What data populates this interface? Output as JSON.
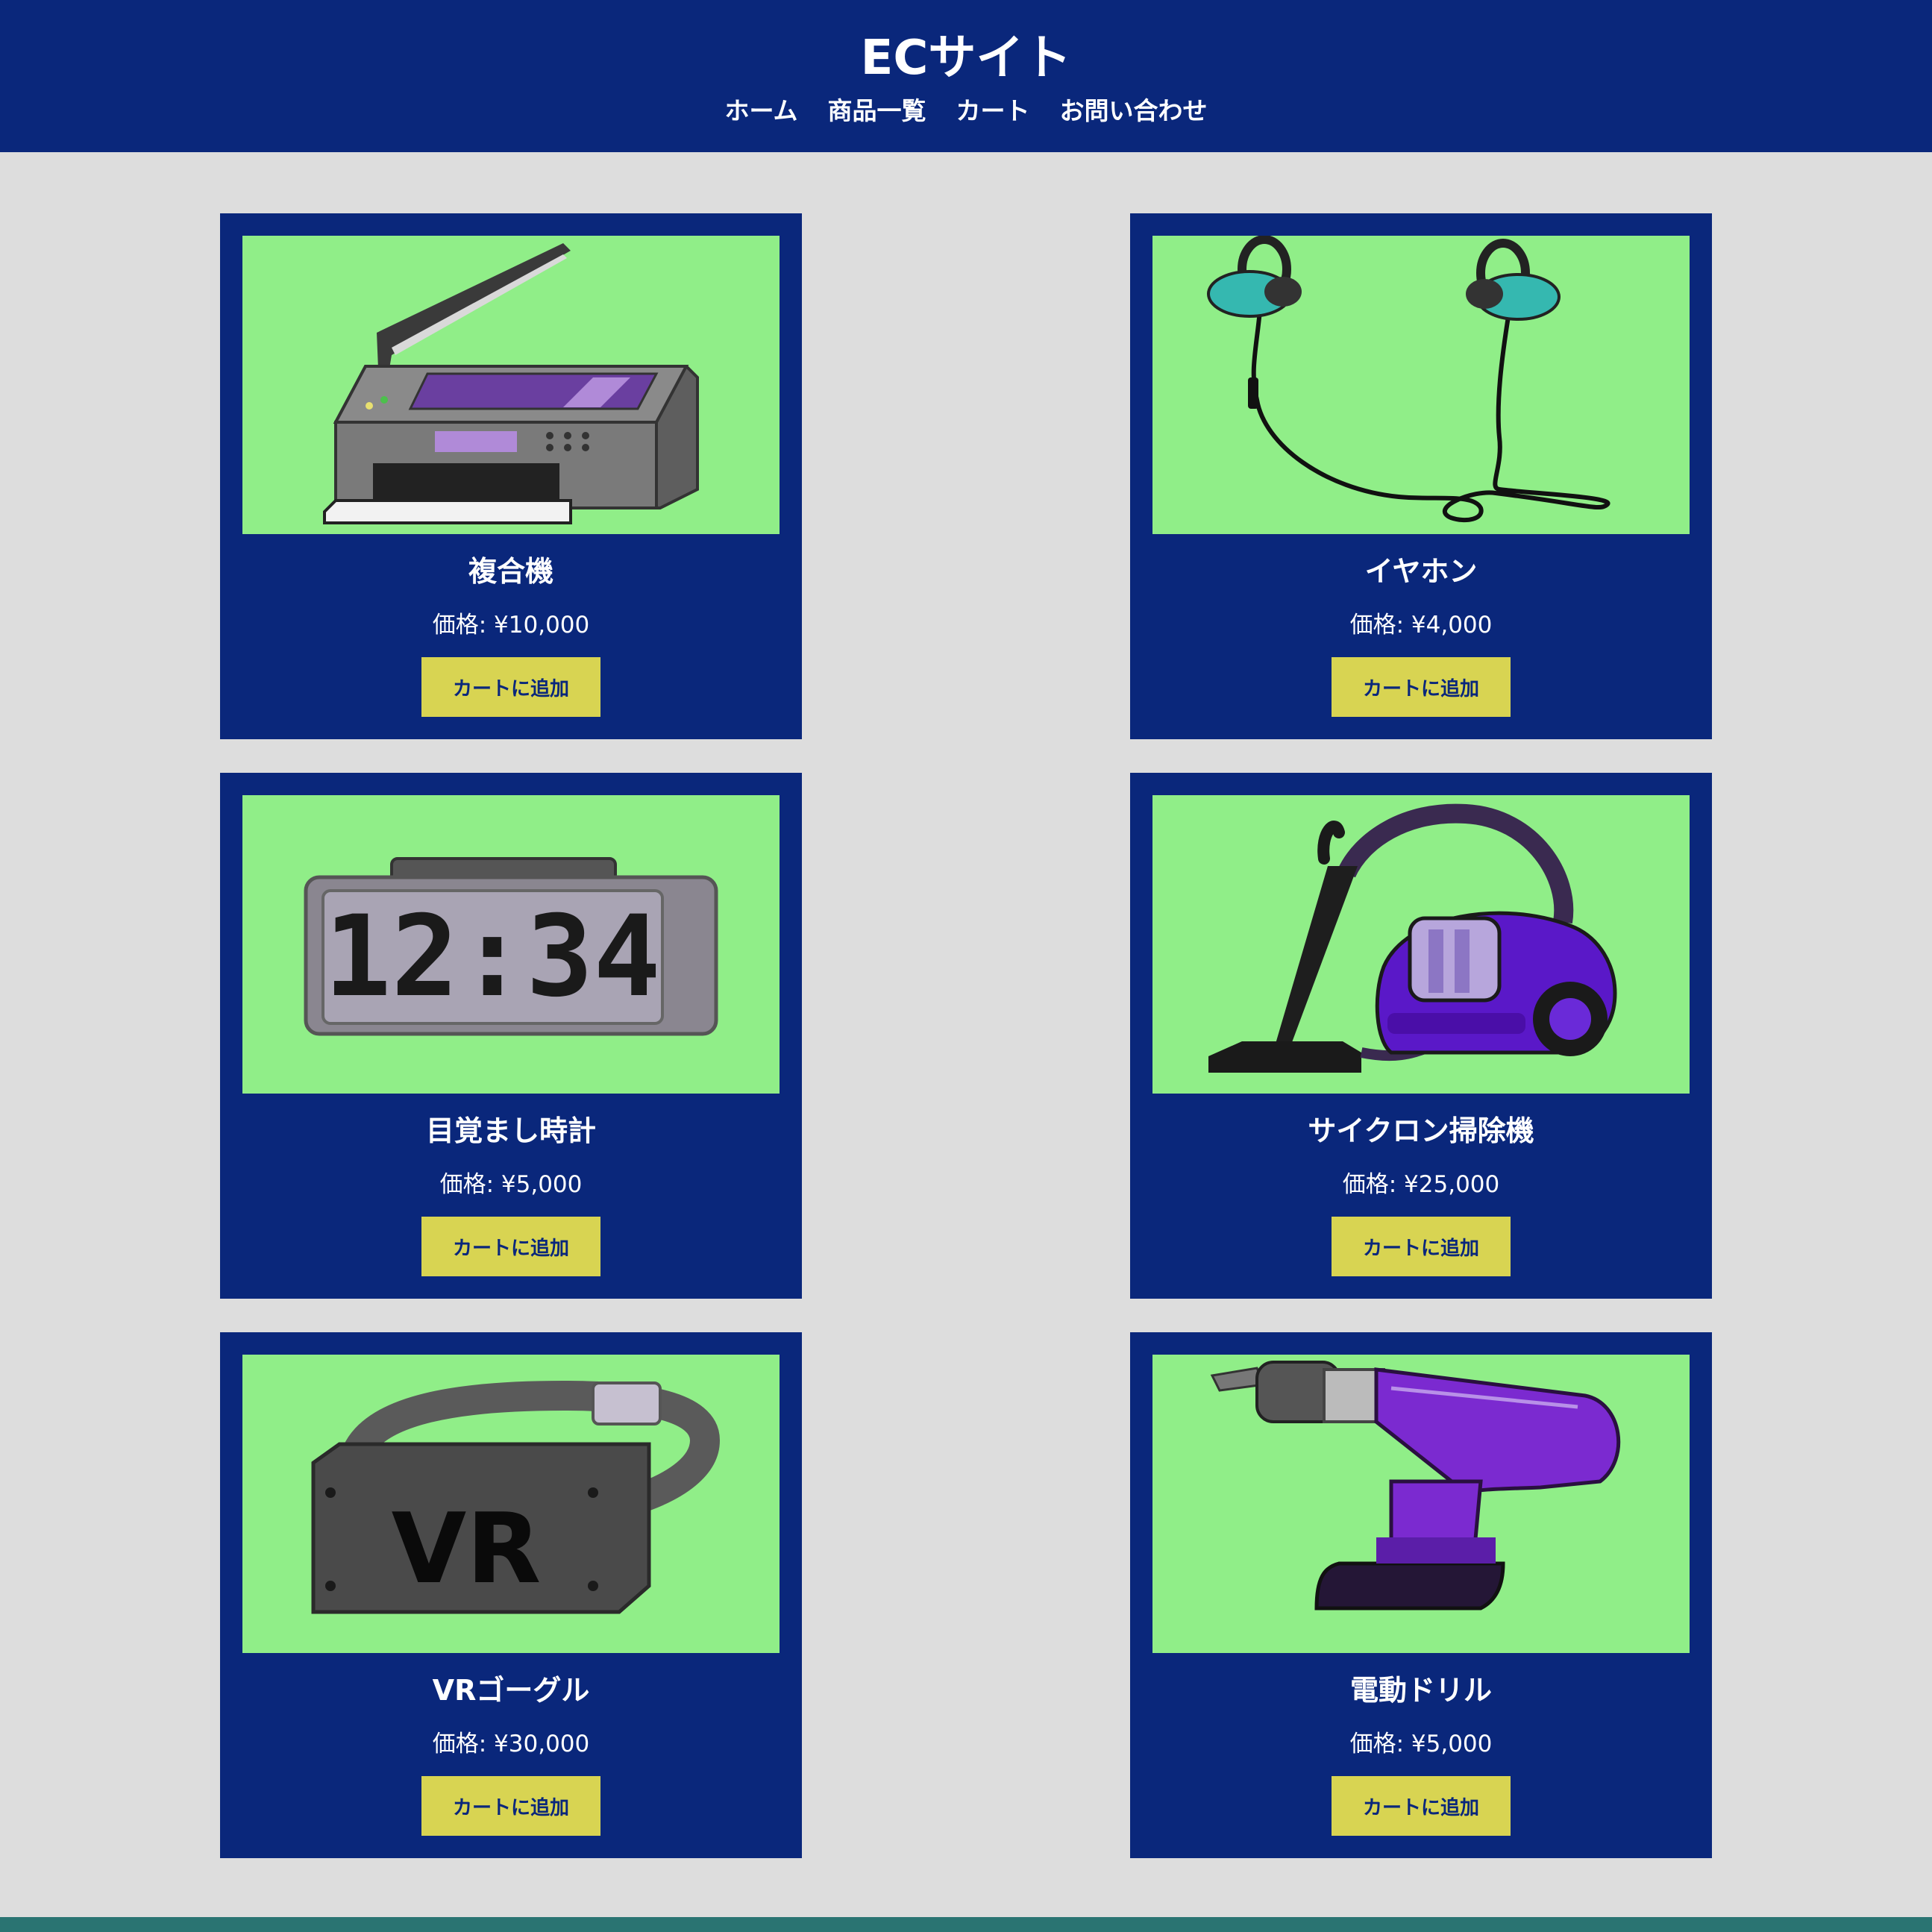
{
  "header": {
    "title": "ECサイト",
    "nav": [
      "ホーム",
      "商品一覧",
      "カート",
      "お問い合わせ"
    ]
  },
  "products": [
    {
      "name": "複合機",
      "price": "価格: ¥10,000",
      "button": "カートに追加",
      "icon": "printer-icon"
    },
    {
      "name": "イヤホン",
      "price": "価格: ¥4,000",
      "button": "カートに追加",
      "icon": "earphones-icon"
    },
    {
      "name": "目覚まし時計",
      "price": "価格: ¥5,000",
      "button": "カートに追加",
      "icon": "alarm-clock-icon",
      "clock_display": "12:34"
    },
    {
      "name": "サイクロン掃除機",
      "price": "価格: ¥25,000",
      "button": "カートに追加",
      "icon": "vacuum-cleaner-icon"
    },
    {
      "name": "VRゴーグル",
      "price": "価格: ¥30,000",
      "button": "カートに追加",
      "icon": "vr-goggles-icon",
      "goggle_label": "VR"
    },
    {
      "name": "電動ドリル",
      "price": "価格: ¥5,000",
      "button": "カートに追加",
      "icon": "electric-drill-icon"
    }
  ],
  "colors": {
    "header_bg": "#0a277b",
    "page_bg": "#dddddd",
    "card_bg": "#0a277b",
    "image_bg": "#90ee88",
    "button_bg": "#d8d452",
    "footer": "#2a7472"
  }
}
